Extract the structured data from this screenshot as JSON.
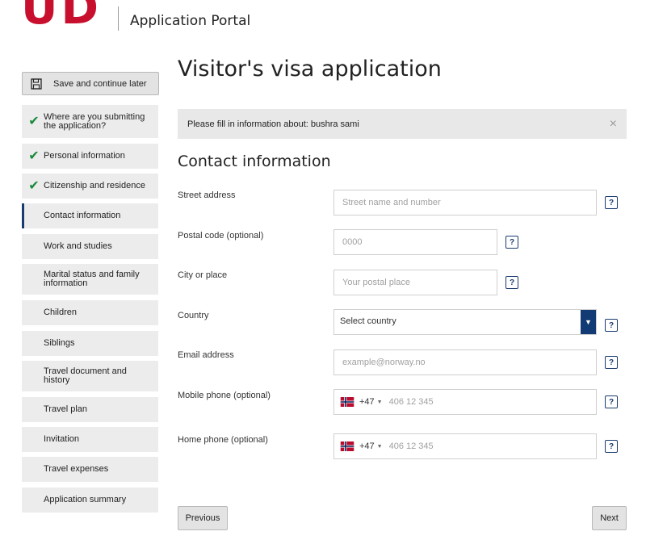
{
  "header": {
    "logo_text": "UDI",
    "portal_title": "Application Portal"
  },
  "sidebar": {
    "save_label": "Save and continue later",
    "items": [
      {
        "label": "Where are you submitting the application?",
        "status": "complete"
      },
      {
        "label": "Personal information",
        "status": "complete"
      },
      {
        "label": "Citizenship and residence",
        "status": "complete"
      },
      {
        "label": "Contact information",
        "status": "active"
      },
      {
        "label": "Work and studies",
        "status": "pending"
      },
      {
        "label": "Marital status and family information",
        "status": "pending"
      },
      {
        "label": "Children",
        "status": "pending"
      },
      {
        "label": "Siblings",
        "status": "pending"
      },
      {
        "label": "Travel document and history",
        "status": "pending"
      },
      {
        "label": "Travel plan",
        "status": "pending"
      },
      {
        "label": "Invitation",
        "status": "pending"
      },
      {
        "label": "Travel expenses",
        "status": "pending"
      },
      {
        "label": "Application summary",
        "status": "pending"
      }
    ]
  },
  "main": {
    "page_title": "Visitor's visa application",
    "notice_text": "Please fill in information about: bushra sami",
    "notice_close": "×",
    "section_title": "Contact information",
    "fields": {
      "street": {
        "label": "Street address",
        "placeholder": "Street name and number",
        "value": ""
      },
      "postal": {
        "label": "Postal code (optional)",
        "placeholder": "0000",
        "value": ""
      },
      "city": {
        "label": "City or place",
        "placeholder": "Your postal place",
        "value": ""
      },
      "country": {
        "label": "Country",
        "selected": "Select country"
      },
      "email": {
        "label": "Email address",
        "placeholder": "example@norway.no",
        "value": ""
      },
      "mobile": {
        "label": "Mobile phone (optional)",
        "country_code": "+47",
        "placeholder": "406 12 345"
      },
      "home": {
        "label": "Home phone (optional)",
        "country_code": "+47",
        "placeholder": "406 12 345"
      }
    },
    "help_label": "?",
    "previous_label": "Previous",
    "next_label": "Next"
  },
  "colors": {
    "brand_red": "#c8102e",
    "accent_navy": "#123a74",
    "check_green": "#1b8a3c"
  },
  "icons": {
    "save": "floppy-disk-icon",
    "check": "checkmark-icon",
    "help": "question-mark-icon",
    "dropdown": "caret-down-icon",
    "flag": "norway-flag-icon",
    "close": "close-icon"
  }
}
